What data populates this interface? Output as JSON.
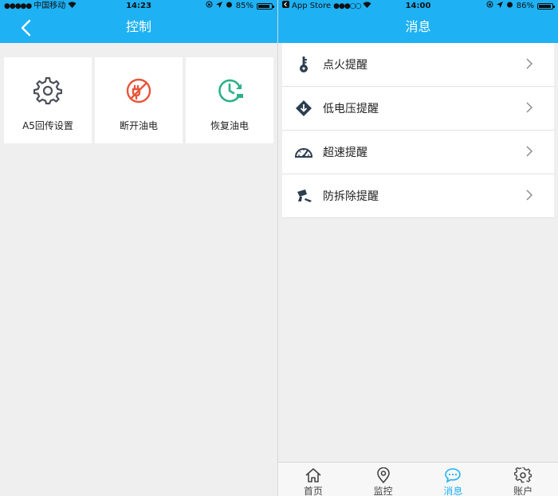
{
  "left": {
    "status": {
      "carrier": "中国移动",
      "time": "14:23",
      "battery": "85%"
    },
    "title": "控制",
    "tiles": [
      {
        "label": "A5回传设置",
        "icon": "gear-icon"
      },
      {
        "label": "断开油电",
        "icon": "power-off-icon"
      },
      {
        "label": "恢复油电",
        "icon": "power-restore-icon"
      }
    ]
  },
  "right": {
    "status": {
      "back_app": "App Store",
      "time": "14:00",
      "battery": "86%"
    },
    "title": "消息",
    "items": [
      {
        "label": "点火提醒",
        "icon": "key-icon"
      },
      {
        "label": "低电压提醒",
        "icon": "low-voltage-icon"
      },
      {
        "label": "超速提醒",
        "icon": "speedometer-icon"
      },
      {
        "label": "防拆除提醒",
        "icon": "tamper-icon"
      }
    ],
    "tabs": [
      {
        "label": "首页",
        "icon": "home-icon"
      },
      {
        "label": "监控",
        "icon": "location-pin-icon"
      },
      {
        "label": "消息",
        "icon": "message-icon"
      },
      {
        "label": "账户",
        "icon": "settings-icon"
      }
    ],
    "active_tab": "消息"
  },
  "colors": {
    "accent": "#1eb1f4",
    "cut_power": "#e8553a",
    "restore_power": "#2bb18a",
    "icon_dark": "#2c3e50"
  }
}
